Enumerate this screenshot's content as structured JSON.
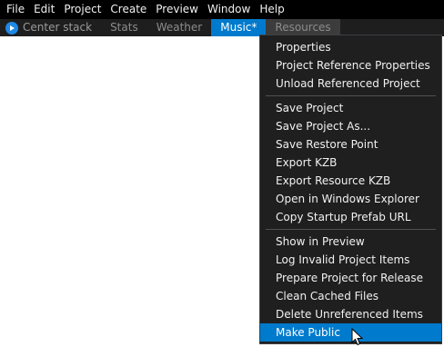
{
  "menubar": {
    "items": [
      "File",
      "Edit",
      "Project",
      "Create",
      "Preview",
      "Window",
      "Help"
    ]
  },
  "tabs": [
    {
      "label": "Center stack",
      "icon": "play-icon"
    },
    {
      "label": "Stats"
    },
    {
      "label": "Weather"
    },
    {
      "label": "Music*",
      "active": true
    },
    {
      "label": "Resources"
    }
  ],
  "context_menu": {
    "group1": [
      "Properties",
      "Project Reference Properties",
      "Unload Referenced Project"
    ],
    "group2": [
      "Save Project",
      "Save Project As...",
      "Save Restore Point",
      "Export KZB",
      "Export Resource KZB",
      "Open in Windows Explorer",
      "Copy Startup Prefab URL"
    ],
    "group3": [
      "Show in Preview",
      "Log Invalid Project Items",
      "Prepare Project for Release",
      "Clean Cached Files",
      "Delete Unreferenced Items",
      "Make Public"
    ],
    "highlighted": "Make Public"
  },
  "colors": {
    "accent": "#007acc",
    "menu_bg": "#1f1f1f",
    "menubar_bg": "#000000"
  }
}
